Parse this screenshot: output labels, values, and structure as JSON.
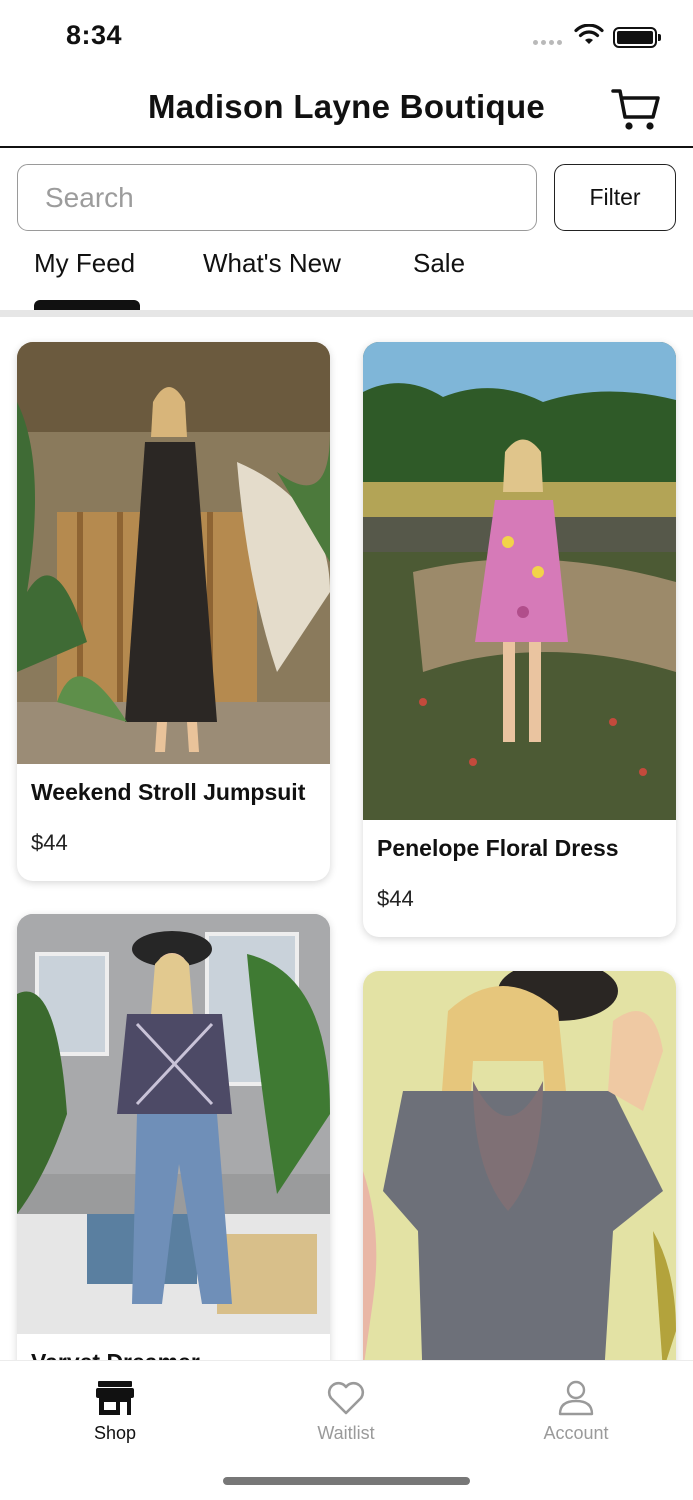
{
  "status_bar": {
    "time": "8:34"
  },
  "header": {
    "title": "Madison Layne Boutique",
    "cart_icon": "cart-icon"
  },
  "search": {
    "placeholder": "Search",
    "value": ""
  },
  "filter": {
    "label": "Filter"
  },
  "tabs": [
    {
      "label": "My Feed",
      "selected": true
    },
    {
      "label": "What's New",
      "selected": false
    },
    {
      "label": "Sale",
      "selected": false
    }
  ],
  "products": [
    {
      "name": "Weekend Stroll Jumpsuit",
      "price": "$44"
    },
    {
      "name": "Penelope Floral Dress",
      "price": "$44"
    },
    {
      "name": "Varvet Dreamer"
    },
    {
      "name": ""
    }
  ],
  "bottom_nav": [
    {
      "label": "Shop",
      "icon": "storefront-icon",
      "active": true
    },
    {
      "label": "Waitlist",
      "icon": "heart-icon",
      "active": false
    },
    {
      "label": "Account",
      "icon": "person-icon",
      "active": false
    }
  ],
  "colors": {
    "accent": "#111111",
    "inactive": "#9a9a9a",
    "divider": "#e6e6e6"
  }
}
